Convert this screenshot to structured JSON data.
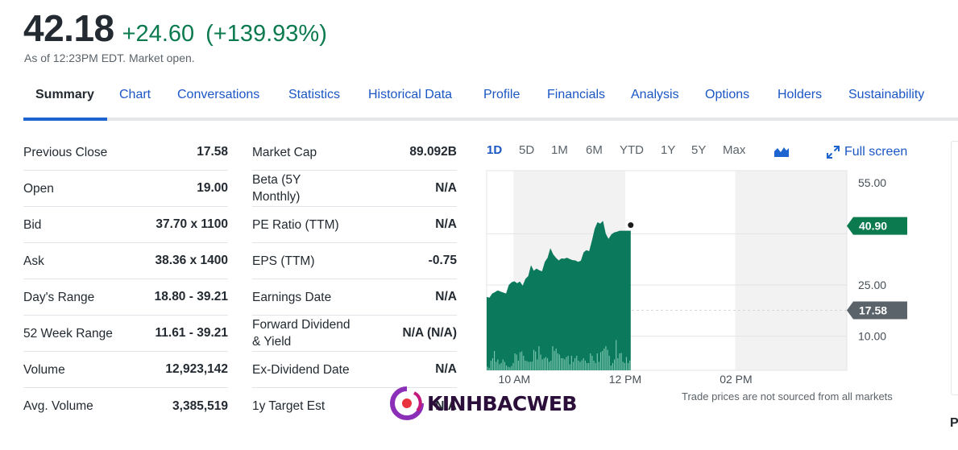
{
  "quote": {
    "price": "42.18",
    "change": "+24.60",
    "change_pct": "(+139.93%)",
    "as_of": "As of 12:23PM EDT. Market open."
  },
  "tabs": [
    {
      "label": "Summary",
      "active": true
    },
    {
      "label": "Chart"
    },
    {
      "label": "Conversations"
    },
    {
      "label": "Statistics"
    },
    {
      "label": "Historical Data"
    },
    {
      "label": "Profile"
    },
    {
      "label": "Financials"
    },
    {
      "label": "Analysis"
    },
    {
      "label": "Options"
    },
    {
      "label": "Holders"
    },
    {
      "label": "Sustainability"
    }
  ],
  "stats_left": [
    {
      "label": "Previous Close",
      "value": "17.58"
    },
    {
      "label": "Open",
      "value": "19.00"
    },
    {
      "label": "Bid",
      "value": "37.70 x 1100"
    },
    {
      "label": "Ask",
      "value": "38.36 x 1400"
    },
    {
      "label": "Day's Range",
      "value": "18.80 - 39.21"
    },
    {
      "label": "52 Week Range",
      "value": "11.61 - 39.21"
    },
    {
      "label": "Volume",
      "value": "12,923,142"
    },
    {
      "label": "Avg. Volume",
      "value": "3,385,519"
    }
  ],
  "stats_right": [
    {
      "label": "Market Cap",
      "value": "89.092B"
    },
    {
      "label": "Beta (5Y Monthly)",
      "value": "N/A"
    },
    {
      "label": "PE Ratio (TTM)",
      "value": "N/A"
    },
    {
      "label": "EPS (TTM)",
      "value": "-0.75"
    },
    {
      "label": "Earnings Date",
      "value": "N/A"
    },
    {
      "label": "Forward Dividend & Yield",
      "value": "N/A (N/A)"
    },
    {
      "label": "Ex-Dividend Date",
      "value": "N/A"
    },
    {
      "label": "1y Target Est",
      "value": "N/A"
    }
  ],
  "chart_controls": {
    "ranges": [
      "1D",
      "5D",
      "1M",
      "6M",
      "YTD",
      "1Y",
      "5Y",
      "Max"
    ],
    "active_range": "1D",
    "chart_type_icon": "mountain-chart-icon",
    "fullscreen_label": "Full screen"
  },
  "chart_note": "Trade prices are not sourced from all markets",
  "watermark": "KINHBACWEB",
  "side_panel_letter": "P",
  "colors": {
    "up": "#0b7a4f",
    "accent": "#1a56c4",
    "prev_close_tag": "#5b636a"
  },
  "chart_data": {
    "type": "area",
    "title": "",
    "xlabel": "",
    "ylabel": "",
    "x_ticks": [
      "10 AM",
      "12 PM",
      "02 PM"
    ],
    "y_ticks": [
      55.0,
      25.0,
      10.0
    ],
    "y_tick_labels": [
      "55.00",
      "25.00",
      "10.00"
    ],
    "ylim": [
      0,
      56
    ],
    "x_range_hours": [
      9.5,
      16.0
    ],
    "grid": true,
    "current_price_tag": "40.90",
    "current_price": 40.9,
    "previous_close_tag": "17.58",
    "previous_close": 17.58,
    "series": [
      {
        "name": "Price",
        "x_hours": [
          9.5,
          9.55,
          9.6,
          9.65,
          9.7,
          9.75,
          9.8,
          9.85,
          9.9,
          9.95,
          10.0,
          10.05,
          10.1,
          10.15,
          10.2,
          10.25,
          10.3,
          10.35,
          10.4,
          10.45,
          10.5,
          10.55,
          10.6,
          10.65,
          10.7,
          10.75,
          10.8,
          10.85,
          10.9,
          10.95,
          11.0,
          11.05,
          11.1,
          11.15,
          11.2,
          11.25,
          11.3,
          11.35,
          11.4,
          11.45,
          11.5,
          11.55,
          11.6,
          11.65,
          11.7,
          11.75,
          11.8,
          11.85,
          11.9,
          11.95,
          12.0,
          12.05,
          12.1
        ],
        "values": [
          21.5,
          21.3,
          22.5,
          22.9,
          23.4,
          23.1,
          22.8,
          22.5,
          25.0,
          25.8,
          26.1,
          25.5,
          26.0,
          24.8,
          26.8,
          27.6,
          30.8,
          29.2,
          29.8,
          29.3,
          29.0,
          31.8,
          33.0,
          35.8,
          34.0,
          33.0,
          32.2,
          32.8,
          32.7,
          33.0,
          32.6,
          32.3,
          32.2,
          31.8,
          32.1,
          34.6,
          35.2,
          34.9,
          38.0,
          41.5,
          43.4,
          43.0,
          43.8,
          40.0,
          38.5,
          39.8,
          40.4,
          40.6,
          40.9,
          40.9,
          40.9,
          40.9,
          40.9
        ]
      },
      {
        "name": "Volume (relative)",
        "values": [
          0.15,
          0.1,
          0.4,
          0.5,
          0.8,
          0.35,
          0.45,
          0.25,
          0.3,
          0.45,
          0.35,
          0.2,
          0.15,
          0.12,
          0.18,
          0.3,
          0.7,
          0.65,
          0.4,
          0.75,
          0.78,
          0.6,
          0.4,
          0.38,
          0.35,
          0.35,
          0.36,
          0.85,
          0.78,
          0.45,
          1.0,
          0.65,
          0.45,
          0.5,
          0.55,
          0.5,
          0.35,
          0.4,
          1.0,
          0.8,
          0.9,
          0.7,
          0.65,
          0.5,
          0.5,
          0.45,
          0.55,
          0.6,
          0.25,
          0.6,
          0.35,
          0.5,
          0.6,
          0.4,
          0.35,
          0.42,
          0.5,
          0.4,
          0.3,
          0.3,
          0.7,
          0.6,
          0.4,
          0.3,
          0.7,
          0.35,
          0.75,
          0.8,
          0.9,
          1.0,
          0.85,
          0.6,
          0.2,
          0.3,
          0.45,
          1.25,
          0.5,
          0.7,
          0.72,
          0.35,
          0.3,
          0.55,
          0.3,
          0.4
        ]
      }
    ],
    "shaded_bands_hours": [
      [
        10.0,
        12.0
      ],
      [
        14.0,
        16.0
      ]
    ]
  }
}
